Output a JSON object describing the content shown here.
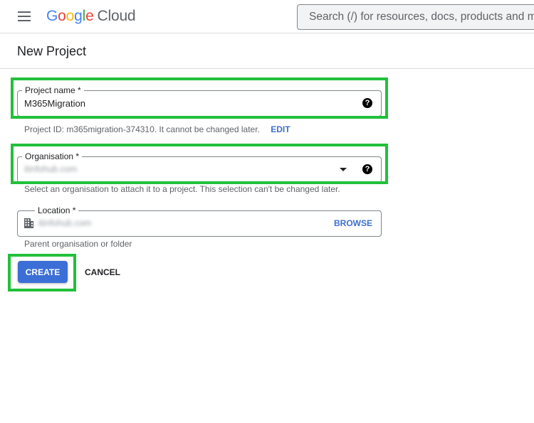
{
  "topbar": {
    "menu_icon": "hamburger-menu-icon",
    "logo": {
      "google_letters": [
        "G",
        "o",
        "o",
        "g",
        "l",
        "e"
      ],
      "product": "Cloud"
    },
    "search": {
      "placeholder": "Search (/) for resources, docs, products and more"
    }
  },
  "page": {
    "title": "New Project"
  },
  "form": {
    "project_name": {
      "label": "Project name *",
      "value": "M365Migration",
      "help_icon": "help-circle-icon",
      "help_glyph": "?",
      "hint": "Project ID: m365migration-374310. It cannot be changed later.",
      "edit_label": "EDIT"
    },
    "organisation": {
      "label": "Organisation *",
      "value": "itinfohub.com",
      "dropdown_icon": "dropdown-arrow-icon",
      "help_icon": "help-circle-icon",
      "help_glyph": "?",
      "hint": "Select an organisation to attach it to a project. This selection can't be changed later."
    },
    "location": {
      "label": "Location *",
      "value": "itinfohub.com",
      "icon": "building-icon",
      "browse_label": "BROWSE",
      "hint": "Parent organisation or folder"
    }
  },
  "actions": {
    "create_label": "CREATE",
    "cancel_label": "CANCEL"
  },
  "colors": {
    "primary": "#3b6fd6",
    "highlight": "#22c03b",
    "link": "#3c6fd1"
  }
}
